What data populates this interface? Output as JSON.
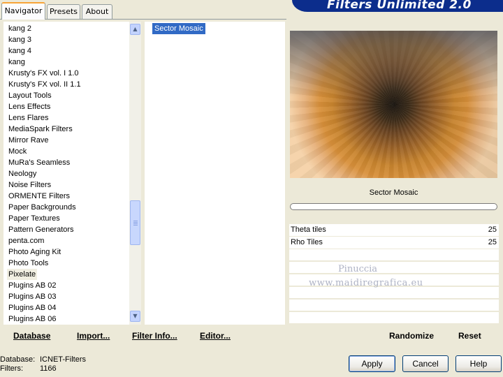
{
  "window": {
    "title": "Filters Unlimited 2.0"
  },
  "tabs": [
    {
      "label": "Navigator",
      "active": true
    },
    {
      "label": "Presets",
      "active": false
    },
    {
      "label": "About",
      "active": false
    }
  ],
  "categories": [
    "kang 2",
    "kang 3",
    "kang 4",
    "kang",
    "Krusty's FX vol. I 1.0",
    "Krusty's FX vol. II 1.1",
    "Layout Tools",
    "Lens Effects",
    "Lens Flares",
    "MediaSpark Filters",
    "Mirror Rave",
    "Mock",
    "MuRa's Seamless",
    "Neology",
    "Noise Filters",
    "ORMENTE Filters",
    "Paper Backgrounds",
    "Paper Textures",
    "Pattern Generators",
    "penta.com",
    "Photo Aging Kit",
    "Photo Tools",
    "Pixelate",
    "Plugins AB 02",
    "Plugins AB 03",
    "Plugins AB 04",
    "Plugins AB 06"
  ],
  "selected_category": "Pixelate",
  "filters": [
    "Sector Mosaic"
  ],
  "selected_filter": "Sector Mosaic",
  "preview": {
    "filter_name": "Sector Mosaic"
  },
  "parameters": [
    {
      "name": "Theta tiles",
      "value": "25"
    },
    {
      "name": "Rho Tiles",
      "value": "25"
    }
  ],
  "watermark": {
    "line1": "Pinuccia",
    "line2": "www.maidiregrafica.eu"
  },
  "toolbar": {
    "database": "Database",
    "import": "Import...",
    "filter_info": "Filter Info...",
    "editor": "Editor...",
    "randomize": "Randomize",
    "reset": "Reset"
  },
  "info": {
    "database_label": "Database:",
    "database_value": "ICNET-Filters",
    "filters_label": "Filters:",
    "filters_value": "1166"
  },
  "buttons": {
    "apply": "Apply",
    "cancel": "Cancel",
    "help": "Help"
  },
  "colors": {
    "banner": "#0c2d8c",
    "selection": "#316ac5",
    "active_tab_accent": "#f7a438"
  }
}
